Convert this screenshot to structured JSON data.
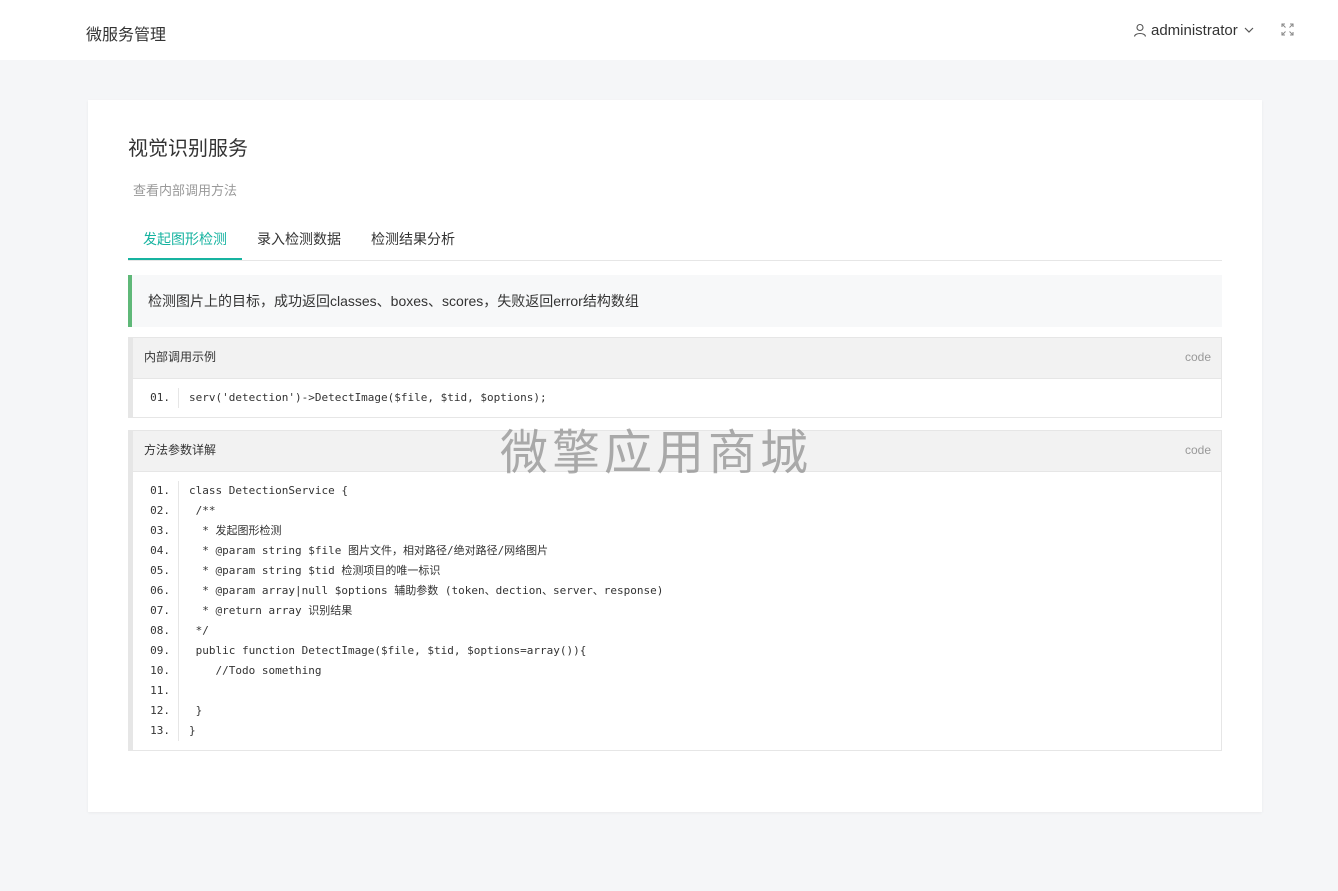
{
  "header": {
    "app_title": "微服务管理",
    "user": "administrator",
    "user_icon": "user-icon",
    "dropdown_icon": "chevron-down-icon",
    "fullscreen_icon": "fullscreen-icon"
  },
  "page": {
    "title": "视觉识别服务",
    "subtitle": "查看内部调用方法"
  },
  "tabs": [
    {
      "label": "发起图形检测",
      "active": true
    },
    {
      "label": "录入检测数据",
      "active": false
    },
    {
      "label": "检测结果分析",
      "active": false
    }
  ],
  "notice": "检测图片上的目标，成功返回classes、boxes、scores，失败返回error结构数组",
  "code_blocks": [
    {
      "title": "内部调用示例",
      "badge": "code",
      "lines": [
        {
          "no": "01.",
          "text": "serv('detection')->DetectImage($file, $tid, $options);"
        }
      ]
    },
    {
      "title": "方法参数详解",
      "badge": "code",
      "lines": [
        {
          "no": "01.",
          "text": "class DetectionService {"
        },
        {
          "no": "02.",
          "text": " /**"
        },
        {
          "no": "03.",
          "text": "  * 发起图形检测"
        },
        {
          "no": "04.",
          "text": "  * @param string $file 图片文件，相对路径/绝对路径/网络图片"
        },
        {
          "no": "05.",
          "text": "  * @param string $tid 检测项目的唯一标识"
        },
        {
          "no": "06.",
          "text": "  * @param array|null $options 辅助参数 (token、dection、server、response)"
        },
        {
          "no": "07.",
          "text": "  * @return array 识别结果"
        },
        {
          "no": "08.",
          "text": " */"
        },
        {
          "no": "09.",
          "text": " public function DetectImage($file, $tid, $options=array()){"
        },
        {
          "no": "10.",
          "text": "    //Todo something"
        },
        {
          "no": "11.",
          "text": ""
        },
        {
          "no": "12.",
          "text": " }"
        },
        {
          "no": "13.",
          "text": "}"
        }
      ]
    }
  ],
  "watermark": "微擎应用商城",
  "colors": {
    "accent": "#16b3a0",
    "notice_bar": "#5fb878",
    "background": "#f5f6f8"
  }
}
